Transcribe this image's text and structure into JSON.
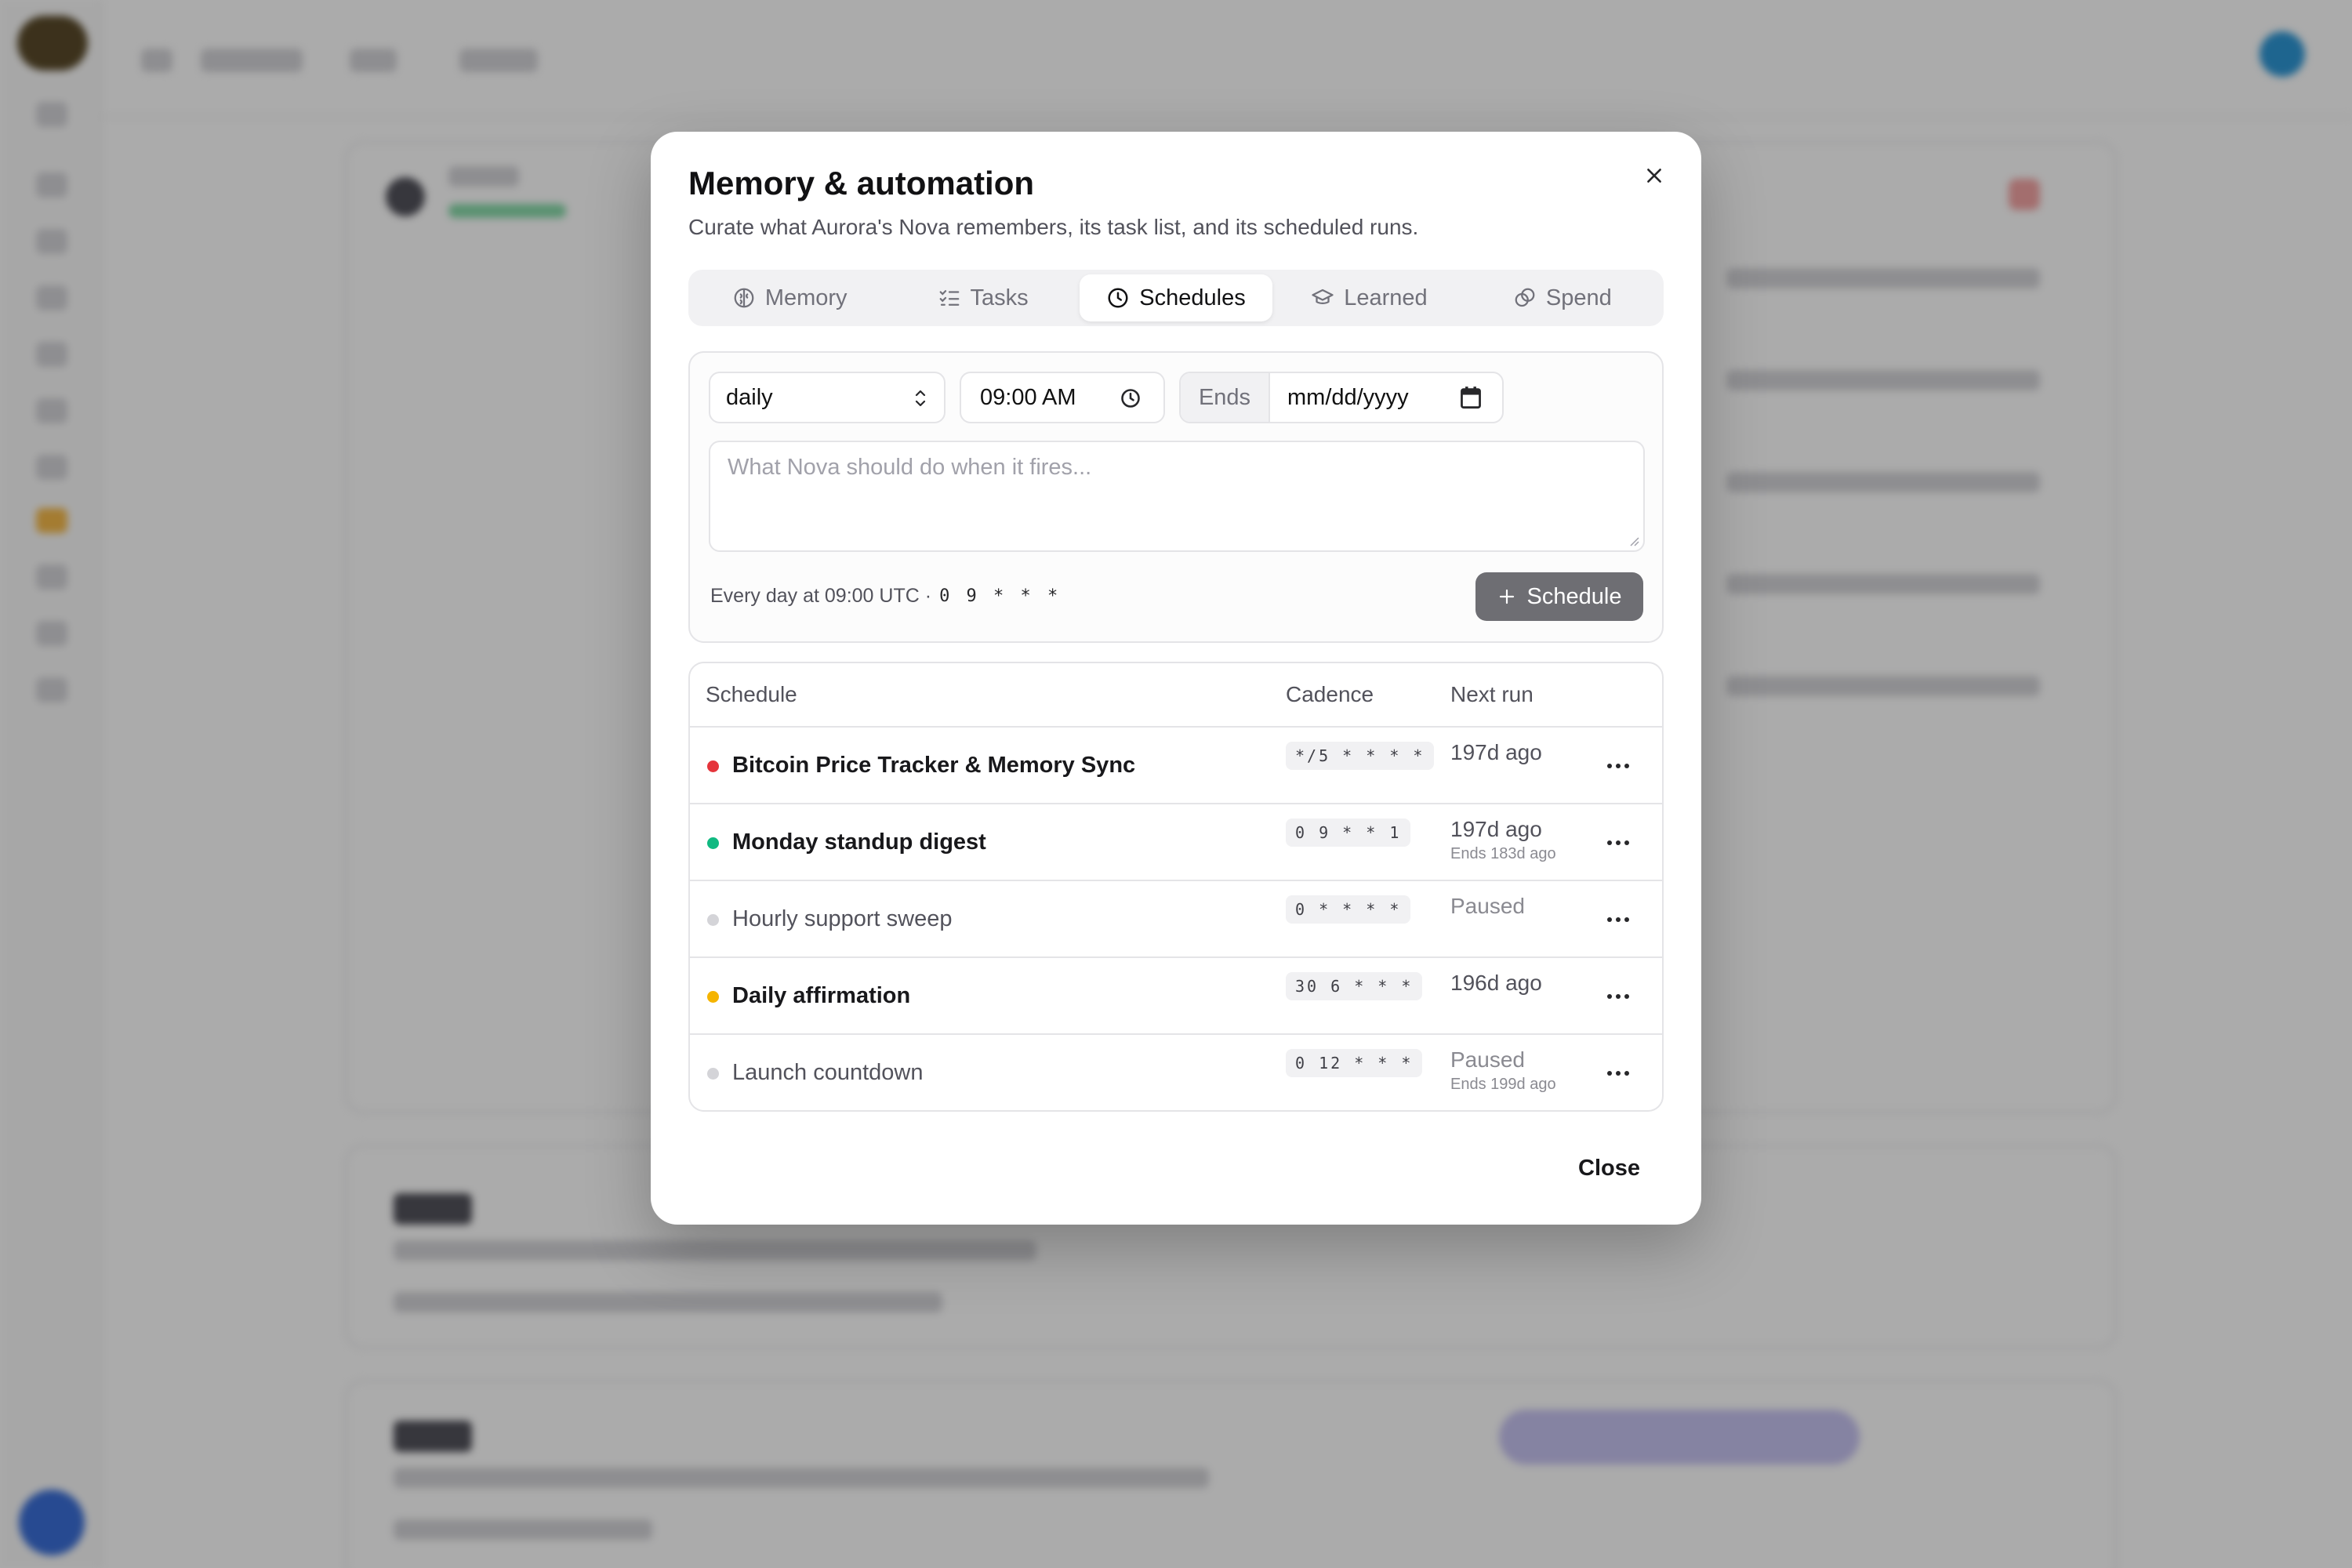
{
  "modal": {
    "title": "Memory & automation",
    "description": "Curate what Aurora's Nova remembers, its task list, and its scheduled runs.",
    "tabs": [
      {
        "label": "Memory",
        "icon": "brain-icon",
        "active": false
      },
      {
        "label": "Tasks",
        "icon": "list-checks-icon",
        "active": false
      },
      {
        "label": "Schedules",
        "icon": "clock-icon",
        "active": true
      },
      {
        "label": "Learned",
        "icon": "graduation-cap-icon",
        "active": false
      },
      {
        "label": "Spend",
        "icon": "coins-icon",
        "active": false
      }
    ],
    "close_label": "Close"
  },
  "form": {
    "frequency": "daily",
    "time": "09:00 AM",
    "ends_label": "Ends",
    "ends_placeholder": "mm/dd/yyyy",
    "prompt_placeholder": "What Nova should do when it fires...",
    "summary": "Every day at 09:00 UTC ·",
    "summary_cron": "0 9 * * *",
    "submit_label": "Schedule"
  },
  "table": {
    "headers": {
      "schedule": "Schedule",
      "cadence": "Cadence",
      "next_run": "Next run"
    },
    "rows": [
      {
        "name": "Bitcoin Price Tracker & Memory Sync",
        "status_color": "#e5343b",
        "cron": "*/5 * * * *",
        "next_run": "197d ago",
        "sub": "",
        "paused": false
      },
      {
        "name": "Monday standup digest",
        "status_color": "#10b981",
        "cron": "0 9 * * 1",
        "next_run": "197d ago",
        "sub": "Ends 183d ago",
        "paused": false
      },
      {
        "name": "Hourly support sweep",
        "status_color": "#d4d4d8",
        "cron": "0 * * * *",
        "next_run": "Paused",
        "sub": "",
        "paused": true
      },
      {
        "name": "Daily affirmation",
        "status_color": "#f5b400",
        "cron": "30 6 * * *",
        "next_run": "196d ago",
        "sub": "",
        "paused": false
      },
      {
        "name": "Launch countdown",
        "status_color": "#d4d4d8",
        "cron": "0 12 * * *",
        "next_run": "Paused",
        "sub": "Ends 199d ago",
        "paused": true
      }
    ]
  }
}
